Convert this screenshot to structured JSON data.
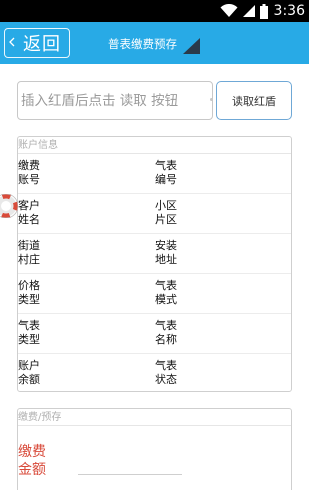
{
  "status_bar": {
    "time": "3:36",
    "icons": [
      "wifi-icon",
      "signal-icon",
      "battery-icon"
    ]
  },
  "app_bar": {
    "back_label": "返回",
    "back_icon": "chevron-left-icon",
    "title": "普表缴费预存",
    "bg_color": "#28aae6"
  },
  "reader": {
    "placeholder": "插入红盾后点击 读取 按钮",
    "button_label": "读取红盾"
  },
  "account_info": {
    "header": "账户信息",
    "rows": [
      {
        "left": "缴费\n账号",
        "right": "气表\n编号"
      },
      {
        "left": "客户\n姓名",
        "right": "小区\n片区"
      },
      {
        "left": "街道\n村庄",
        "right": "安装\n地址"
      },
      {
        "left": "价格\n类型",
        "right": "气表\n模式"
      },
      {
        "left": "气表\n类型",
        "right": "气表\n名称"
      },
      {
        "left": "账户\n余额",
        "right": "气表\n状态"
      }
    ]
  },
  "payment": {
    "header": "缴费/预存",
    "amount_label": "缴费\n金额",
    "amount_value": "",
    "label_color": "#d84a3a"
  }
}
